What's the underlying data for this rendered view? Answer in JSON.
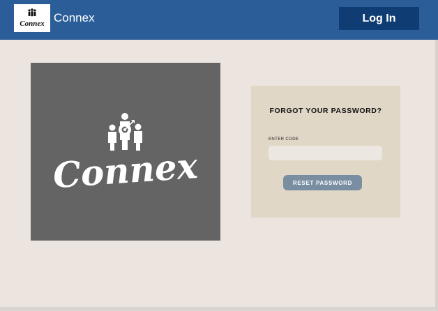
{
  "header": {
    "logo_text": "Connex",
    "brand_name": "Connex",
    "login_label": "Log In"
  },
  "hero": {
    "logo_text": "Connex",
    "icon": "team-target-icon"
  },
  "forgot_password": {
    "title": "FORGOT YOUR PASSWORD?",
    "code_label": "ENTER CODE",
    "code_value": "",
    "reset_label": "RESET PASSWORD"
  },
  "colors": {
    "header": "#2b5e99",
    "login_button": "#0f3d73",
    "page_background": "#ece4de",
    "hero_background": "#646464",
    "card_background": "#e0d7c7",
    "reset_button": "#7a8ea2"
  }
}
